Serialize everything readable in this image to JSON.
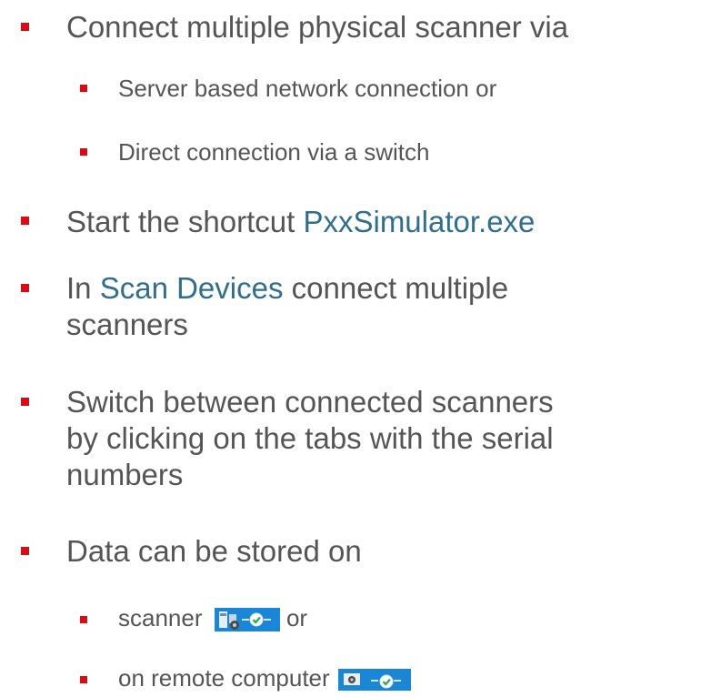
{
  "bullets": {
    "b1": "Connect multiple physical scanner via",
    "b1a": "Server based network connection or",
    "b1b": "Direct connection via a switch",
    "b2_pre": "Start the shortcut ",
    "b2_hl": "PxxSimulator.exe",
    "b3_pre": "In ",
    "b3_hl": "Scan Devices",
    "b3_post": " connect multiple",
    "b3_line2": "scanners",
    "b4_line1": "Switch between connected scanners",
    "b4_line2": "by clicking on the tabs with the serial",
    "b4_line3": "numbers",
    "b5": "Data can be stored on",
    "b5a_pre": "scanner",
    "b5a_post": " or",
    "b5b_pre": "on remote computer"
  },
  "colors": {
    "bullet": "#e30613",
    "text": "#555555",
    "highlight": "#2e6e8e",
    "icon_bg": "#1a86d6"
  },
  "icons": {
    "scanner_storage": "scanner-storage-connected-icon",
    "remote_storage": "remote-computer-storage-connected-icon"
  }
}
